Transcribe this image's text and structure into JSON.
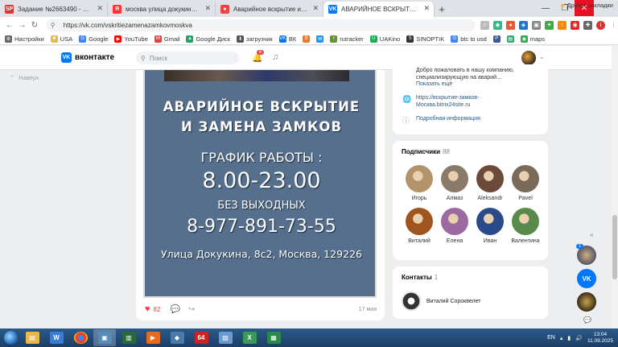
{
  "browser": {
    "tabs": [
      {
        "title": "Задание №2663490 - просмотр з",
        "favicon": "SP",
        "color": "#d33"
      },
      {
        "title": "москва улица докукина 8 стр 2 и",
        "favicon": "Я",
        "color": "#f33"
      },
      {
        "title": "Аварийное вскрытие и замена за",
        "favicon": "●",
        "color": "#e44"
      },
      {
        "title": "АВАРИЙНОЕ ВСКРЫТИЕ И ЗАМЕ",
        "favicon": "VK",
        "color": "#0077ff"
      }
    ],
    "new_tab": "+",
    "url": "https://vk.com/vskritiezamenazamkovmoskva",
    "bookmarks": [
      {
        "label": "Настройки",
        "icon": "⚙",
        "color": "#666"
      },
      {
        "label": "USA",
        "icon": "■",
        "color": "#e8b84a"
      },
      {
        "label": "Google",
        "icon": "G",
        "color": "#4285f4"
      },
      {
        "label": "YouTube",
        "icon": "▶",
        "color": "#f00"
      },
      {
        "label": "Gmail",
        "icon": "M",
        "color": "#d44"
      },
      {
        "label": "Google Диск",
        "icon": "▲",
        "color": "#1fa463"
      },
      {
        "label": "загрузчик",
        "icon": "⬇",
        "color": "#555"
      },
      {
        "label": "ВК",
        "icon": "VK",
        "color": "#0077ff"
      },
      {
        "label": "",
        "icon": "B",
        "color": "#e07b39"
      },
      {
        "label": "",
        "icon": "✉",
        "color": "#2196f3"
      },
      {
        "label": "rutracker",
        "icon": "r",
        "color": "#6a8f3a"
      },
      {
        "label": "UAKino",
        "icon": "U",
        "color": "#2a5"
      },
      {
        "label": "SINOPTIK",
        "icon": "S",
        "color": "#333"
      },
      {
        "label": "btc to usd",
        "icon": "G",
        "color": "#4285f4"
      },
      {
        "label": "",
        "icon": "P",
        "color": "#3b5998"
      },
      {
        "label": "",
        "icon": "▤",
        "color": "#3a7"
      },
      {
        "label": "maps",
        "icon": "◉",
        "color": "#34a853"
      }
    ],
    "other_bookmarks": "Другие закладки"
  },
  "vk": {
    "logo_text": "вконтакте",
    "search_placeholder": "Поиск",
    "notifications_count": "6",
    "back_label": "Наверх"
  },
  "post": {
    "poster_lines": [
      "АВАРИЙНОЕ ВСКРЫТИЕ",
      "И ЗАМЕНА  ЗАМКОВ",
      "ГРАФИК РАБОТЫ :",
      "8.00-23.00",
      "БЕЗ ВЫХОДНЫХ",
      "8-977-891-73-55",
      "Улица Докукина, 8с2, Москва, 129226"
    ],
    "likes": "82",
    "date": "17 мая"
  },
  "info": {
    "description": "Добро пожаловать в нашу компанию, специализирующую на аварий…",
    "show_more": "Показать ещё",
    "link": "https://вскрытие-замков-Москва.bitrix24site.ru",
    "details": "Подробная информация"
  },
  "subscribers": {
    "title": "Подписчики",
    "count": "88",
    "people": [
      {
        "name": "Игорь",
        "color": "#b3936a"
      },
      {
        "name": "Алмаз",
        "color": "#8a7a6a"
      },
      {
        "name": "Aleksandr",
        "color": "#6b4a3a"
      },
      {
        "name": "Pavel",
        "color": "#7a6a5a"
      },
      {
        "name": "Виталий",
        "color": "#a0541e"
      },
      {
        "name": "Елена",
        "color": "#9a6aa0"
      },
      {
        "name": "Иван",
        "color": "#2b4a8a"
      },
      {
        "name": "Валентина",
        "color": "#5a8a4a"
      }
    ]
  },
  "contacts": {
    "title": "Контакты",
    "count": "1",
    "person": "Виталий Сороквелет"
  },
  "mini_sidebar": {
    "badge": "1"
  },
  "taskbar": {
    "lang": "EN",
    "time": "13:04",
    "date": "11.09.2025"
  }
}
